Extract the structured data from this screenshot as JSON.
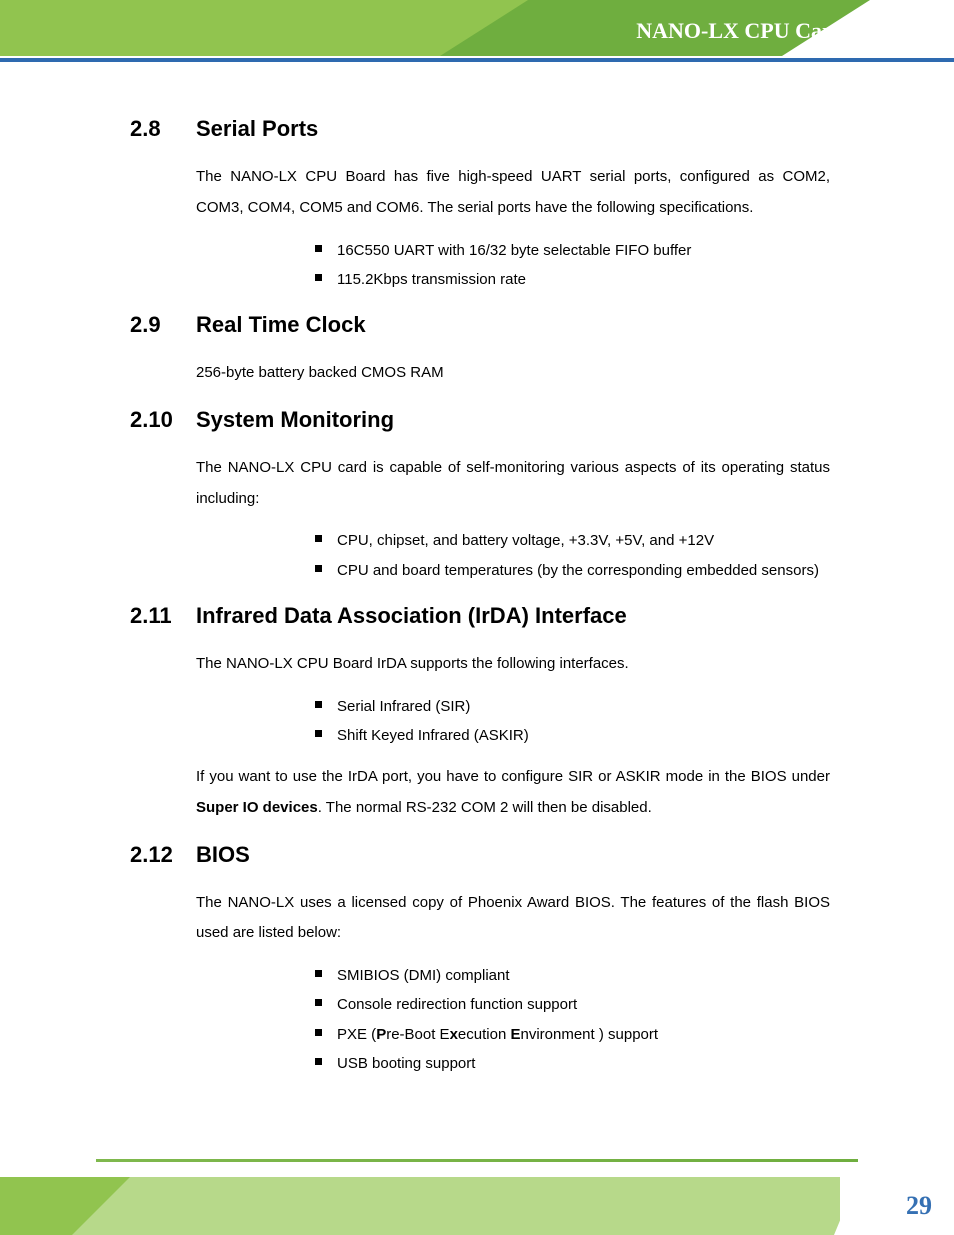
{
  "header": {
    "title": "NANO-LX CPU Card"
  },
  "footer": {
    "page": "29"
  },
  "s28": {
    "num": "2.8",
    "title": "Serial Ports",
    "p1": "The NANO-LX CPU Board has five high-speed UART serial ports, configured as COM2, COM3, COM4, COM5 and COM6. The serial ports have the following specifications.",
    "li1": "16C550 UART with 16/32 byte selectable FIFO buffer",
    "li2": "115.2Kbps transmission rate"
  },
  "s29": {
    "num": "2.9",
    "title": "Real Time Clock",
    "p1": "256-byte battery backed CMOS RAM"
  },
  "s210": {
    "num": "2.10",
    "title": "System Monitoring",
    "p1": "The NANO-LX CPU card is capable of self-monitoring various aspects of its operating status including:",
    "li1": "CPU, chipset, and battery voltage, +3.3V, +5V, and +12V",
    "li2": "CPU and board temperatures (by the corresponding embedded sensors)"
  },
  "s211": {
    "num": "2.11",
    "title": "Infrared Data Association (IrDA) Interface",
    "p1": "The NANO-LX CPU Board IrDA supports the following interfaces.",
    "li1": "Serial Infrared (SIR)",
    "li2": "Shift Keyed Infrared (ASKIR)",
    "p2a": "If you want to use the IrDA port, you have to configure SIR or ASKIR mode in the BIOS under ",
    "p2b": "Super IO devices",
    "p2c": ". The normal RS-232 COM 2 will then be disabled."
  },
  "s212": {
    "num": "2.12",
    "title": "BIOS",
    "p1": "The NANO-LX uses a licensed copy of Phoenix Award BIOS. The features of the flash BIOS used are listed below:",
    "li1": "SMIBIOS (DMI) compliant",
    "li2": "Console redirection function support",
    "li3a": "PXE (",
    "li3b": "P",
    "li3c": "re-Boot E",
    "li3d": "x",
    "li3e": "ecution ",
    "li3f": "E",
    "li3g": "nvironment ) support",
    "li4": "USB booting support"
  }
}
